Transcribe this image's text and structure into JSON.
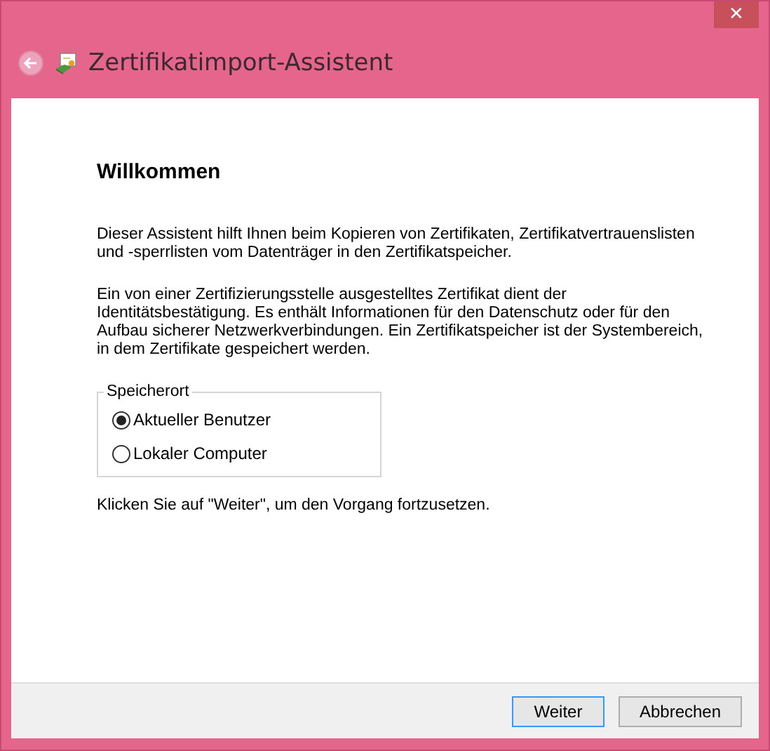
{
  "window": {
    "title": "Zertifikatimport-Assistent",
    "close": "✕"
  },
  "page": {
    "heading": "Willkommen",
    "paragraphs": [
      "Dieser Assistent hilft Ihnen beim Kopieren von Zertifikaten, Zertifikatvertrauenslisten und -sperrlisten vom Datenträger in den Zertifikatspeicher.",
      "Ein von einer Zertifizierungsstelle ausgestelltes Zertifikat dient der Identitätsbestätigung. Es enthält Informationen für den Datenschutz oder für den Aufbau sicherer Netzwerkverbindungen. Ein Zertifikatspeicher ist der Systembereich, in dem Zertifikate gespeichert werden."
    ],
    "storage": {
      "legend": "Speicherort",
      "options": [
        {
          "label": "Aktueller Benutzer",
          "selected": true
        },
        {
          "label": "Lokaler Computer",
          "selected": false
        }
      ]
    },
    "note": "Klicken Sie auf \"Weiter\", um den Vorgang fortzusetzen."
  },
  "buttons": [
    {
      "label": "Weiter",
      "default": true
    },
    {
      "label": "Abbrechen",
      "default": false
    }
  ]
}
